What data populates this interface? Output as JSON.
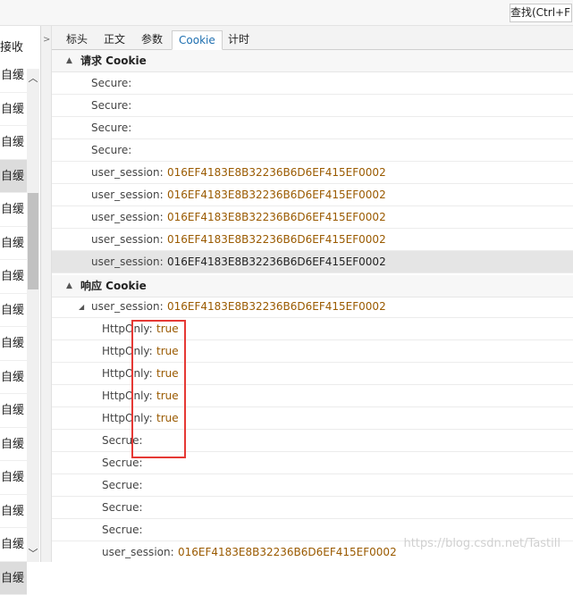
{
  "toolbar": {
    "find_label": "查找(Ctrl+F)"
  },
  "left_pane": {
    "header": "接收",
    "rows": [
      "自缓",
      "自缓",
      "自缓",
      "自缓",
      "自缓",
      "自缓",
      "自缓",
      "自缓",
      "自缓",
      "自缓",
      "自缓",
      "自缓",
      "自缓",
      "自缓",
      "自缓",
      "自缓"
    ],
    "selected_rows": [
      3,
      15
    ]
  },
  "collapse_arrow": ">",
  "tabs": [
    {
      "label": "标头",
      "active": false
    },
    {
      "label": "正文",
      "active": false
    },
    {
      "label": "参数",
      "active": false
    },
    {
      "label": "Cookie",
      "active": true
    },
    {
      "label": "计时",
      "active": false
    }
  ],
  "request_section": {
    "title": "请求 Cookie",
    "rows": [
      {
        "key": "Secure:",
        "value": ""
      },
      {
        "key": "Secure:",
        "value": ""
      },
      {
        "key": "Secure:",
        "value": ""
      },
      {
        "key": "Secure:",
        "value": ""
      },
      {
        "key": "user_session:",
        "value": "016EF4183E8B32236B6D6EF415EF0002"
      },
      {
        "key": "user_session:",
        "value": "016EF4183E8B32236B6D6EF415EF0002"
      },
      {
        "key": "user_session:",
        "value": "016EF4183E8B32236B6D6EF415EF0002"
      },
      {
        "key": "user_session:",
        "value": "016EF4183E8B32236B6D6EF415EF0002"
      },
      {
        "key": "user_session:",
        "value": "016EF4183E8B32236B6D6EF415EF0002"
      }
    ]
  },
  "response_section": {
    "title": "响应 Cookie",
    "parent": {
      "key": "user_session:",
      "value": "016EF4183E8B32236B6D6EF415EF0002"
    },
    "rows": [
      {
        "key": "HttpOnly:",
        "value": "true"
      },
      {
        "key": "HttpOnly:",
        "value": "true"
      },
      {
        "key": "HttpOnly:",
        "value": "true"
      },
      {
        "key": "HttpOnly:",
        "value": "true"
      },
      {
        "key": "HttpOnly:",
        "value": "true"
      },
      {
        "key": "Secrue:",
        "value": ""
      },
      {
        "key": "Secrue:",
        "value": ""
      },
      {
        "key": "Secrue:",
        "value": ""
      },
      {
        "key": "Secrue:",
        "value": ""
      },
      {
        "key": "Secrue:",
        "value": ""
      },
      {
        "key": "user_session:",
        "value": "016EF4183E8B32236B6D6EF415EF0002"
      }
    ]
  },
  "watermark": "https://blog.csdn.net/Tastill",
  "colors": {
    "accent": "#1e6fb0",
    "value": "#9a5a00",
    "highlight": "#e53935"
  }
}
